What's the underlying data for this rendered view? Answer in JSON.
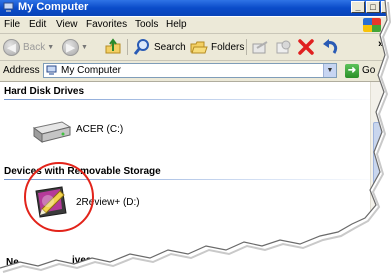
{
  "window": {
    "title": "My Computer",
    "buttons": {
      "minimize": "_",
      "maximize": "□",
      "close": "x"
    }
  },
  "menu": [
    "File",
    "Edit",
    "View",
    "Favorites",
    "Tools",
    "Help"
  ],
  "toolbar": {
    "back_label": "Back",
    "search_label": "Search",
    "folders_label": "Folders",
    "more_label": "»"
  },
  "address": {
    "label": "Address",
    "value": "My Computer",
    "go_label": "Go"
  },
  "groups": {
    "hard_disk": {
      "title": "Hard Disk Drives",
      "items": [
        {
          "label": "ACER (C:)"
        }
      ]
    },
    "removable": {
      "title": "Devices with Removable Storage",
      "items": [
        {
          "label": "2Review+ (D:)"
        }
      ]
    },
    "network": {
      "title": "Network Drives",
      "visible_fragments": [
        "Ne",
        "ives"
      ]
    }
  },
  "colors": {
    "titlebar": "#0a4cc9",
    "chrome": "#ece9d8",
    "highlight_circle": "#e2231a"
  }
}
